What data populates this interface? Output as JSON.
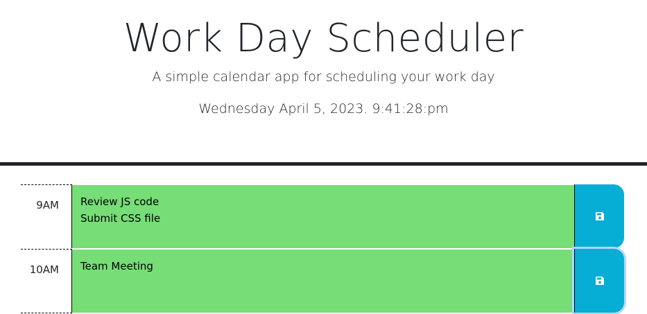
{
  "header": {
    "title": "Work Day Scheduler",
    "subtitle": "A simple calendar app for scheduling your work day",
    "current_date": "Wednesday April 5, 2023. 9:41:28:pm"
  },
  "colors": {
    "present": "#77dd77",
    "save_button": "#06aed5",
    "header_border": "#212529"
  },
  "time_blocks": [
    {
      "hour": "9AM",
      "text": "Review JS code\nSubmit CSS file",
      "save_icon": "floppy-disk-icon"
    },
    {
      "hour": "10AM",
      "text": "Team Meeting",
      "save_icon": "floppy-disk-icon"
    }
  ]
}
